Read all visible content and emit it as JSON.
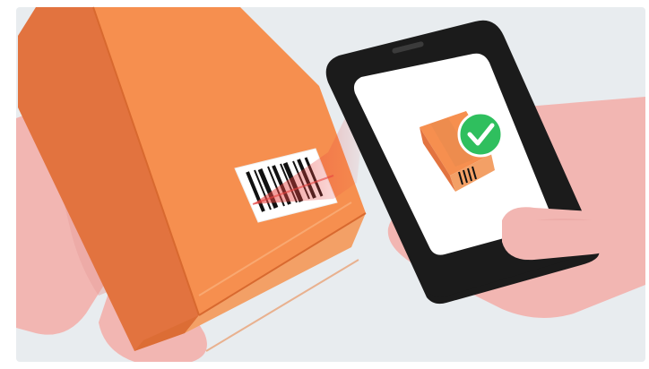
{
  "scene": {
    "colors": {
      "background": "#e8ecef",
      "frame": "#ffffff",
      "box_front": "#f68f4f",
      "box_side": "#e2733f",
      "box_bottom": "#f3a066",
      "box_edge": "#d8692f",
      "skin": "#f2b6b2",
      "skin_shadow": "#e79e9a",
      "phone_body": "#1b1b1b",
      "phone_screen": "#ffffff",
      "check_green": "#2fbf5e",
      "scan_red": "#e8433f",
      "barcode_black": "#111111"
    },
    "icons": [
      "parcel-box-icon",
      "barcode-icon",
      "smartphone-icon",
      "checkmark-icon"
    ]
  }
}
